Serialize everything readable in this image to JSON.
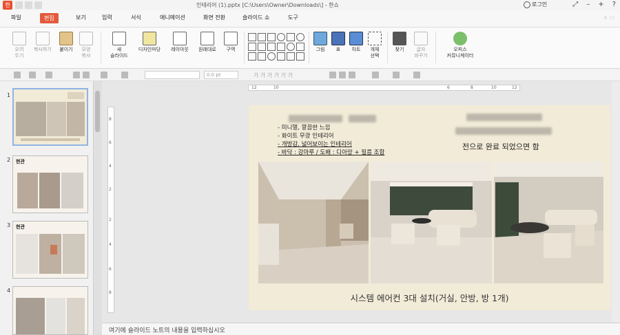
{
  "window": {
    "title": "인테리어 (1).pptx [C:\\Users\\Owner\\Downloads\\] - 한쇼",
    "login_label": "로그인",
    "app_icon_glyph": "한",
    "controls": [
      "⤢",
      "–",
      "+",
      "?"
    ]
  },
  "menu": {
    "items": [
      "파일",
      "편집",
      "보기",
      "입력",
      "서식",
      "애니메이션",
      "화면 전환",
      "슬라이드 쇼",
      "도구"
    ],
    "active_index": 1,
    "accent": "#e35a3c"
  },
  "ribbon": {
    "clipboard": [
      "오려\n두기",
      "복사하기",
      "붙이기",
      "모양\n복사"
    ],
    "slide": [
      "새\n슬라이드",
      "디자인마당",
      "레이아웃",
      "원래대로",
      "구역"
    ],
    "insert": [
      "그림",
      "표",
      "차트",
      "개체\n선택"
    ],
    "find": [
      "찾기",
      "글자\n바꾸기"
    ],
    "office": [
      "오피스\n커뮤니케이터"
    ]
  },
  "formatbar": {
    "font_size": "0.0",
    "font_size_unit": "pt",
    "font_glyphs": "가 가 가 가 가 가"
  },
  "ruler": {
    "top_labels": [
      "12",
      "10",
      "6",
      "8",
      "10",
      "12"
    ],
    "left_labels": [
      "8",
      "6",
      "4",
      "2",
      "2",
      "4",
      "6",
      "8"
    ]
  },
  "slides_panel": {
    "numbers": [
      "1",
      "2",
      "3",
      "4"
    ],
    "titles": [
      "",
      "현관",
      "현관",
      ""
    ]
  },
  "slide": {
    "bullets": [
      "- 미니멀, 깔끔한 느낌",
      "- 화이트 무광 인테리어",
      "- 개방감, 넓어보이는 인테리어",
      "- 바닥 : 강마루 / 도배 : 디아망 + 필름 조합"
    ],
    "right_note": "전으로 완료 되었으면 함",
    "caption": "시스템 에어컨 3대 설치(거실, 안방, 방 1개)",
    "bg_color": "#f2ebd8"
  },
  "notes_placeholder": "여기에 슬라이드 노트의 내용을 입력하십시오"
}
